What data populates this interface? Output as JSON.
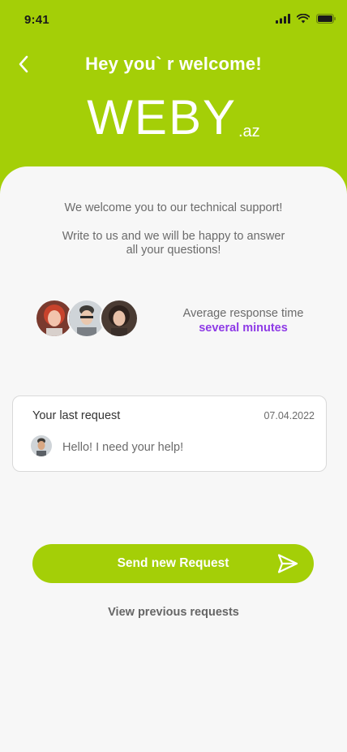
{
  "status_bar": {
    "time": "9:41",
    "icons": [
      "signal-icon",
      "wifi-icon",
      "battery-icon"
    ]
  },
  "header": {
    "back_icon": "chevron-left-icon",
    "title": "Hey you` r welcome!",
    "logo_main": "WEBY",
    "logo_tld": ".az"
  },
  "intro": {
    "welcome": "We welcome you to our technical support!",
    "write_line_1": "Write to us and we will be happy to answer",
    "write_line_2": "all your questions!"
  },
  "response_time": {
    "label": "Average response time",
    "value": "several minutes"
  },
  "last_request": {
    "title": "Your last request",
    "date": "07.04.2022",
    "message": "Hello! I need your help!"
  },
  "actions": {
    "send_label": "Send new Request",
    "send_icon": "send-icon",
    "view_previous": "View previous requests"
  },
  "colors": {
    "brand": "#a4cf07",
    "accent": "#8e3ae6",
    "background": "#f7f7f7",
    "text_muted": "#6b6b6b"
  }
}
